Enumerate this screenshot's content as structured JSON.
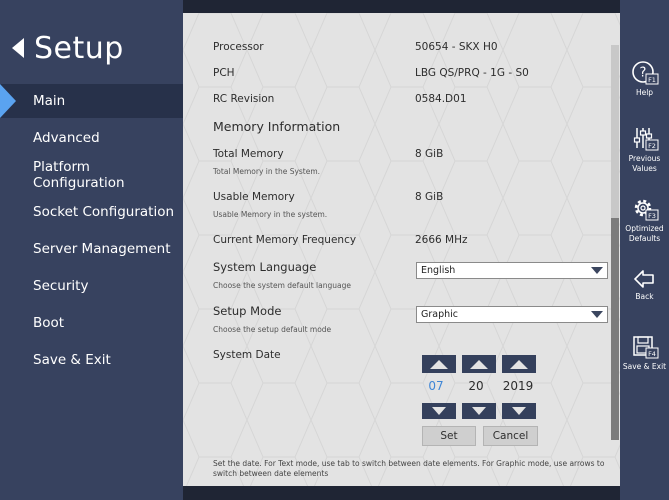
{
  "sidebar": {
    "title": "Setup",
    "items": [
      {
        "label": "Main",
        "active": true
      },
      {
        "label": "Advanced",
        "active": false
      },
      {
        "label": "Platform Configuration",
        "active": false
      },
      {
        "label": "Socket Configuration",
        "active": false
      },
      {
        "label": "Server Management",
        "active": false
      },
      {
        "label": "Security",
        "active": false
      },
      {
        "label": "Boot",
        "active": false
      },
      {
        "label": "Save & Exit",
        "active": false
      }
    ]
  },
  "main": {
    "processor": {
      "label": "Processor",
      "value": "50654 - SKX H0"
    },
    "pch": {
      "label": "PCH",
      "value": "LBG QS/PRQ - 1G - S0"
    },
    "rc_revision": {
      "label": "RC Revision",
      "value": "0584.D01"
    },
    "memory_section": "Memory Information",
    "total_memory": {
      "label": "Total Memory",
      "value": "8 GiB",
      "help": "Total Memory in the System."
    },
    "usable_memory": {
      "label": "Usable Memory",
      "value": "8 GiB",
      "help": "Usable Memory in the system."
    },
    "memory_frequency": {
      "label": "Current Memory Frequency",
      "value": "2666 MHz"
    },
    "system_language": {
      "label": "System Language",
      "help": "Choose the system default language",
      "selected": "English"
    },
    "setup_mode": {
      "label": "Setup Mode",
      "help": "Choose the setup default mode",
      "selected": "Graphic"
    },
    "system_date": {
      "label": "System Date",
      "month": "07",
      "day": "20",
      "year": "2019"
    },
    "set_button": "Set",
    "cancel_button": "Cancel",
    "footer_help": "Set the date. For Text mode, use tab to switch between date elements. For Graphic mode, use arrows to switch between date elements"
  },
  "function_keys": [
    {
      "key": "F1",
      "label": "Help",
      "icon": "help-icon"
    },
    {
      "key": "F2",
      "label": "Previous Values",
      "icon": "sliders-icon"
    },
    {
      "key": "F3",
      "label": "Optimized Defaults",
      "icon": "gear-icon"
    },
    {
      "key": "",
      "label": "Back",
      "icon": "back-arrow-icon"
    },
    {
      "key": "F4",
      "label": "Save & Exit",
      "icon": "save-icon"
    }
  ],
  "colors": {
    "sidebar_bg": "#37425f",
    "active_marker": "#5aa3f0",
    "selected_date_field": "#3f86d6",
    "content_bg": "#e3e3e3"
  }
}
